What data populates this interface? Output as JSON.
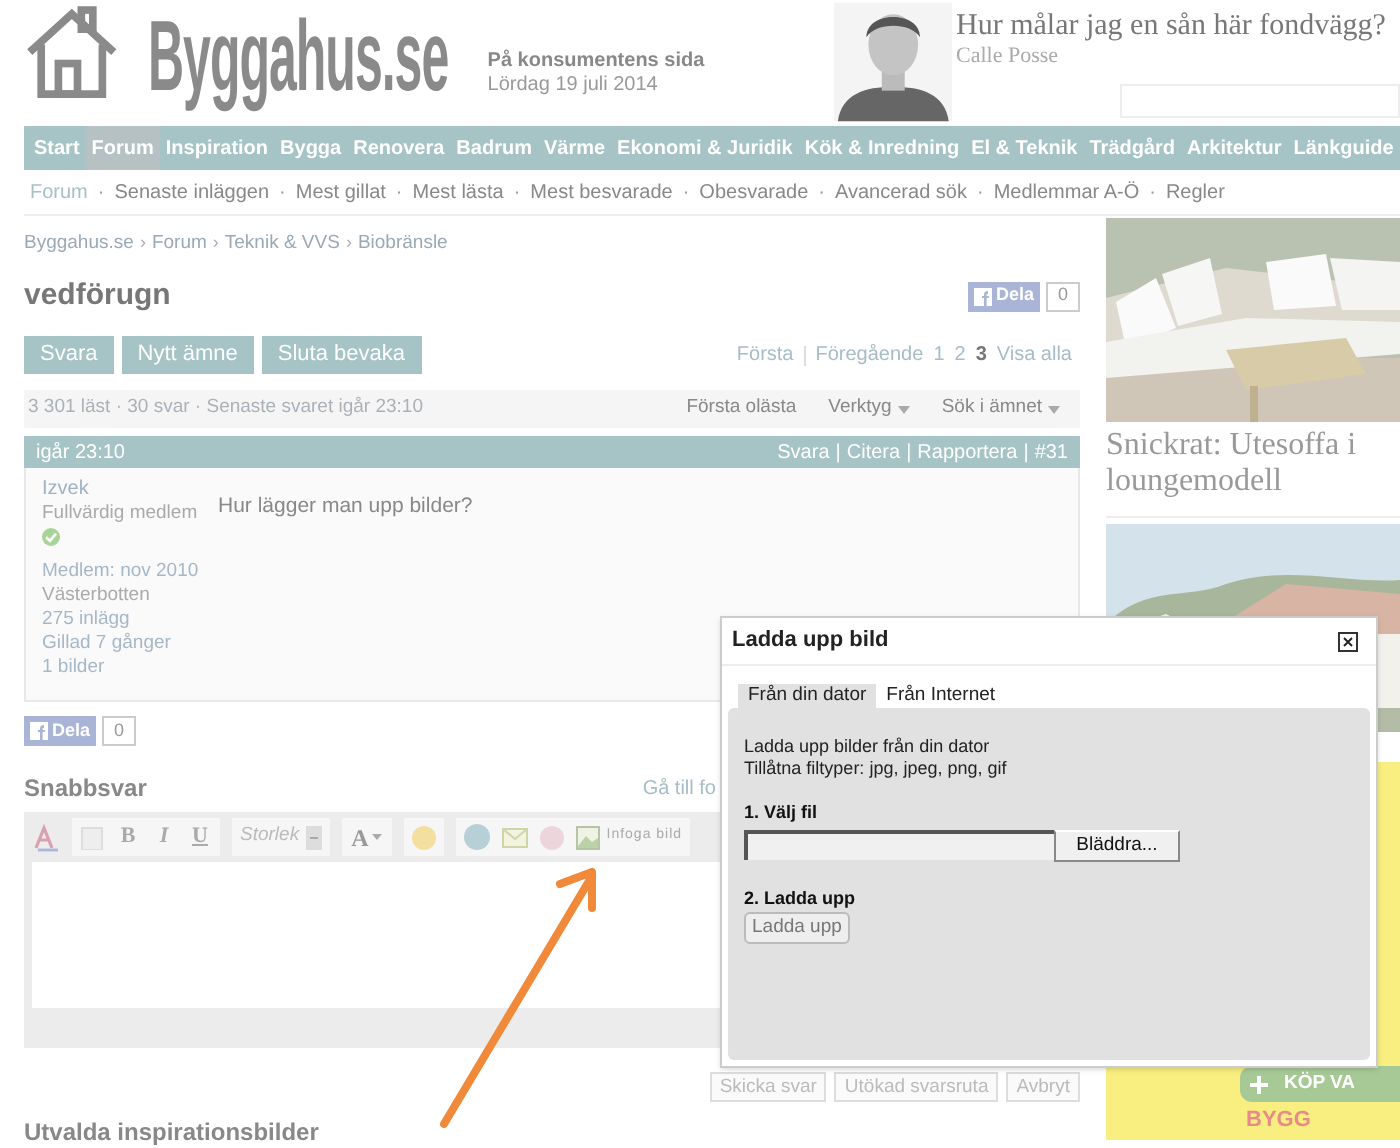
{
  "header": {
    "logo": "Byggahus.se",
    "tagline": "På konsumentens sida",
    "date": "Lördag 19 juli 2014",
    "teaser": {
      "title": "Hur målar jag en sån här fondvägg?",
      "author": "Calle Posse"
    }
  },
  "nav": [
    {
      "label": "Start",
      "selected": false
    },
    {
      "label": "Forum",
      "selected": true
    },
    {
      "label": "Inspiration",
      "selected": false
    },
    {
      "label": "Bygga",
      "selected": false
    },
    {
      "label": "Renovera",
      "selected": false
    },
    {
      "label": "Badrum",
      "selected": false
    },
    {
      "label": "Värme",
      "selected": false
    },
    {
      "label": "Ekonomi & Juridik",
      "selected": false
    },
    {
      "label": "Kök & Inredning",
      "selected": false
    },
    {
      "label": "El & Teknik",
      "selected": false
    },
    {
      "label": "Trädgård",
      "selected": false
    },
    {
      "label": "Arkitektur",
      "selected": false
    },
    {
      "label": "Länkguide",
      "selected": false
    }
  ],
  "subnav": [
    {
      "label": "Forum",
      "selected": true
    },
    {
      "label": "Senaste inläggen",
      "selected": false
    },
    {
      "label": "Mest gillat",
      "selected": false
    },
    {
      "label": "Mest lästa",
      "selected": false
    },
    {
      "label": "Mest besvarade",
      "selected": false
    },
    {
      "label": "Obesvarade",
      "selected": false
    },
    {
      "label": "Avancerad sök",
      "selected": false
    },
    {
      "label": "Medlemmar A-Ö",
      "selected": false
    },
    {
      "label": "Regler",
      "selected": false
    }
  ],
  "subnav_separator": "·",
  "breadcrumb": [
    "Byggahus.se",
    "Forum",
    "Teknik & VVS",
    "Biobränsle"
  ],
  "breadcrumb_separator": "›",
  "thread": {
    "title": "vedförugn",
    "share": {
      "label": "Dela",
      "count": "0"
    },
    "buttons": [
      "Svara",
      "Nytt ämne",
      "Sluta bevaka"
    ],
    "pagination": [
      {
        "label": "Första",
        "selected": false
      },
      {
        "label": "Föregående",
        "selected": false
      },
      {
        "label": "1",
        "selected": false
      },
      {
        "label": "2",
        "selected": false
      },
      {
        "label": "3",
        "selected": true
      },
      {
        "label": "Visa alla",
        "selected": false
      }
    ],
    "stats": "3 301 läst · 30 svar · Senaste svaret igår 23:10",
    "tools": [
      {
        "label": "Första olästa",
        "dropdown": false
      },
      {
        "label": "Verktyg",
        "dropdown": true
      },
      {
        "label": "Sök i ämnet",
        "dropdown": true
      }
    ]
  },
  "post": {
    "time": "igår 23:10",
    "actions": [
      "Svara",
      "Citera",
      "Rapportera",
      "#31"
    ],
    "actions_separator": "|",
    "author": {
      "name": "Izvek",
      "rank": "Fullvärdig medlem",
      "verified": true,
      "details": [
        "Medlem: nov 2010",
        "Västerbotten",
        "275 inlägg",
        "Gillad 7 gånger",
        "1 bilder"
      ]
    },
    "text": "Hur lägger man upp bilder?",
    "share": {
      "label": "Dela",
      "count": "0"
    }
  },
  "quick_reply": {
    "title": "Snabbsvar",
    "link": "Gå till fo",
    "toolbar": {
      "bold": "B",
      "italic": "I",
      "underline": "U",
      "size": "Storlek",
      "font_button": "A",
      "insert_image": "Infoga bild"
    },
    "buttons": [
      "Skicka svar",
      "Utökad svarsruta",
      "Avbryt"
    ]
  },
  "featured_title": "Utvalda inspirationsbilder",
  "sidebar": {
    "cards": [
      {
        "kind": "picture",
        "prefix": "Snickrat:",
        "title": "Utesoffa i loungemodell"
      },
      {
        "kind": "picture"
      }
    ],
    "ad": {
      "button": "KÖP VA",
      "brand": "BYGG"
    }
  },
  "dialog": {
    "title": "Ladda upp bild",
    "tabs": [
      {
        "label": "Från din dator",
        "selected": true
      },
      {
        "label": "Från Internet",
        "selected": false
      }
    ],
    "lines": [
      "Ladda upp bilder från din dator",
      "Tillåtna filtyper: jpg, jpeg, png, gif"
    ],
    "file_label": "1. Välj fil",
    "browse": "Bläddra...",
    "upload_label": "2. Ladda upp",
    "upload_button": "Ladda upp"
  }
}
